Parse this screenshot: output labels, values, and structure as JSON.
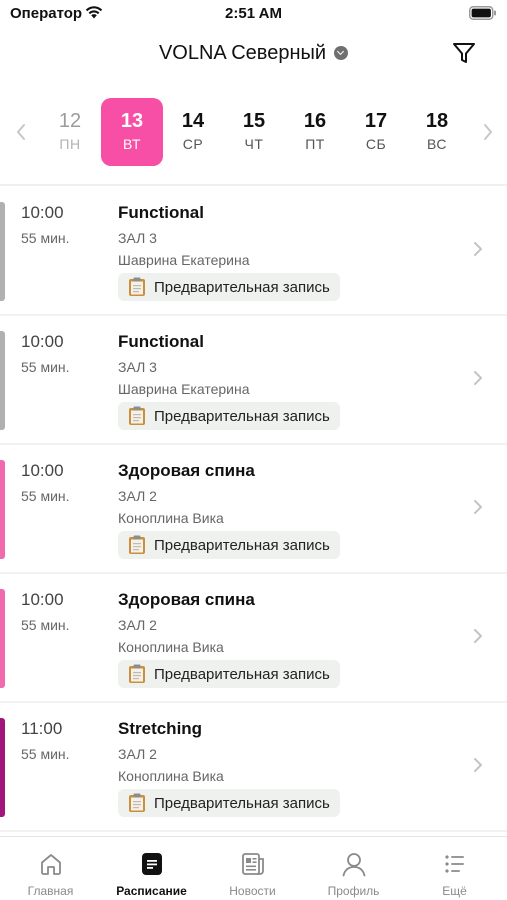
{
  "status_bar": {
    "carrier": "Оператор",
    "time": "2:51 AM"
  },
  "header": {
    "title": "VOLNA Северный"
  },
  "week": {
    "days": [
      {
        "num": "12",
        "weekday": "ПН"
      },
      {
        "num": "13",
        "weekday": "ВТ"
      },
      {
        "num": "14",
        "weekday": "СР"
      },
      {
        "num": "15",
        "weekday": "ЧТ"
      },
      {
        "num": "16",
        "weekday": "ПТ"
      },
      {
        "num": "17",
        "weekday": "СБ"
      },
      {
        "num": "18",
        "weekday": "ВС"
      }
    ]
  },
  "classes": [
    {
      "time": "10:00",
      "duration": "55 мин.",
      "name": "Functional",
      "hall": "ЗАЛ 3",
      "trainer": "Шаврина Екатерина",
      "booking": "Предварительная запись",
      "color": "#b0b0b0"
    },
    {
      "time": "10:00",
      "duration": "55 мин.",
      "name": "Functional",
      "hall": "ЗАЛ 3",
      "trainer": "Шаврина Екатерина",
      "booking": "Предварительная запись",
      "color": "#b0b0b0"
    },
    {
      "time": "10:00",
      "duration": "55 мин.",
      "name": "Здоровая спина",
      "hall": "ЗАЛ 2",
      "trainer": "Коноплина Вика",
      "booking": "Предварительная запись",
      "color": "#f06aae"
    },
    {
      "time": "10:00",
      "duration": "55 мин.",
      "name": "Здоровая спина",
      "hall": "ЗАЛ 2",
      "trainer": "Коноплина Вика",
      "booking": "Предварительная запись",
      "color": "#f06aae"
    },
    {
      "time": "11:00",
      "duration": "55 мин.",
      "name": "Stretching",
      "hall": "ЗАЛ 2",
      "trainer": "Коноплина Вика",
      "booking": "Предварительная запись",
      "color": "#a0157e"
    }
  ],
  "tabbar": {
    "tabs": [
      {
        "label": "Главная",
        "icon": "home-icon"
      },
      {
        "label": "Расписание",
        "icon": "schedule-icon"
      },
      {
        "label": "Новости",
        "icon": "news-icon"
      },
      {
        "label": "Профиль",
        "icon": "profile-icon"
      },
      {
        "label": "Ещё",
        "icon": "more-icon"
      }
    ]
  },
  "colors": {
    "accent": "#f84fa6"
  }
}
